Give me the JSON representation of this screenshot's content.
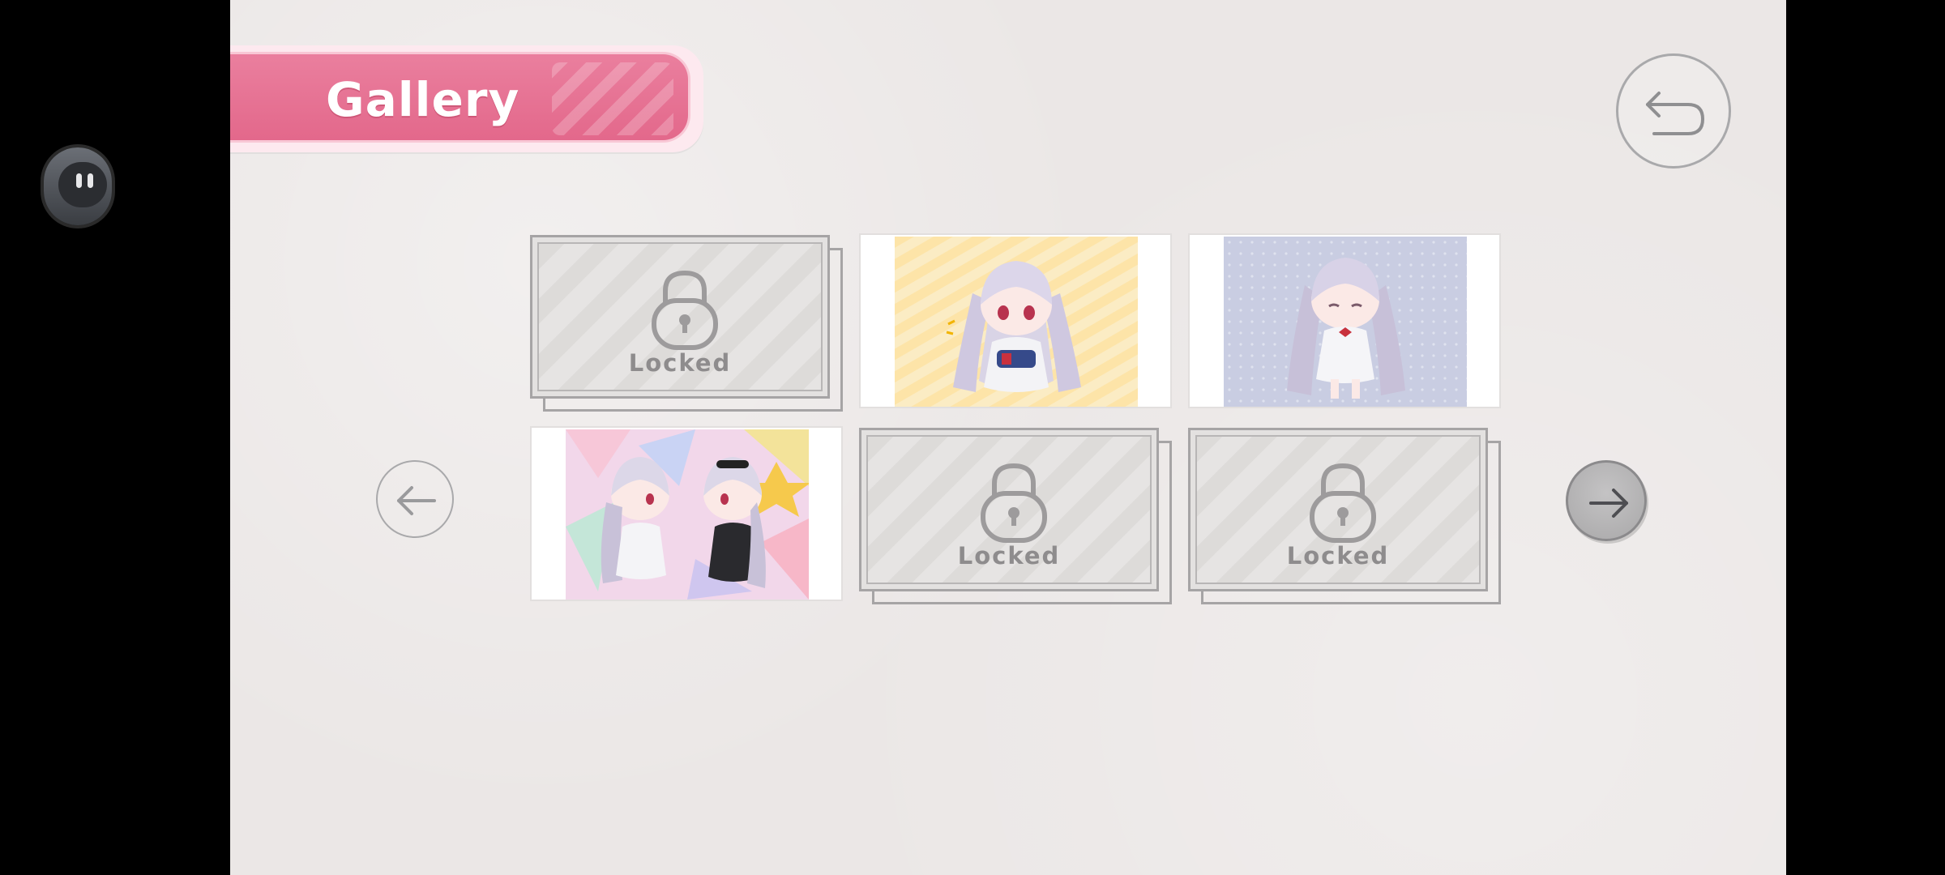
{
  "header": {
    "title": "Gallery"
  },
  "gallery": {
    "items": [
      {
        "state": "locked",
        "label": "Locked"
      },
      {
        "state": "unlocked",
        "alt": "chibi-girl-with-game-console"
      },
      {
        "state": "unlocked",
        "alt": "chibi-girl-blue-polka-dot"
      },
      {
        "state": "unlocked",
        "alt": "two-chibi-girls-playing"
      },
      {
        "state": "locked",
        "label": "Locked"
      },
      {
        "state": "locked",
        "label": "Locked"
      }
    ]
  },
  "nav": {
    "prev_icon": "arrow-left-icon",
    "next_icon": "arrow-right-icon",
    "back_icon": "undo-arrow-icon"
  },
  "colors": {
    "banner": "#e3688b",
    "background": "#ebe7e6",
    "locked_text": "#8e8c8d"
  }
}
